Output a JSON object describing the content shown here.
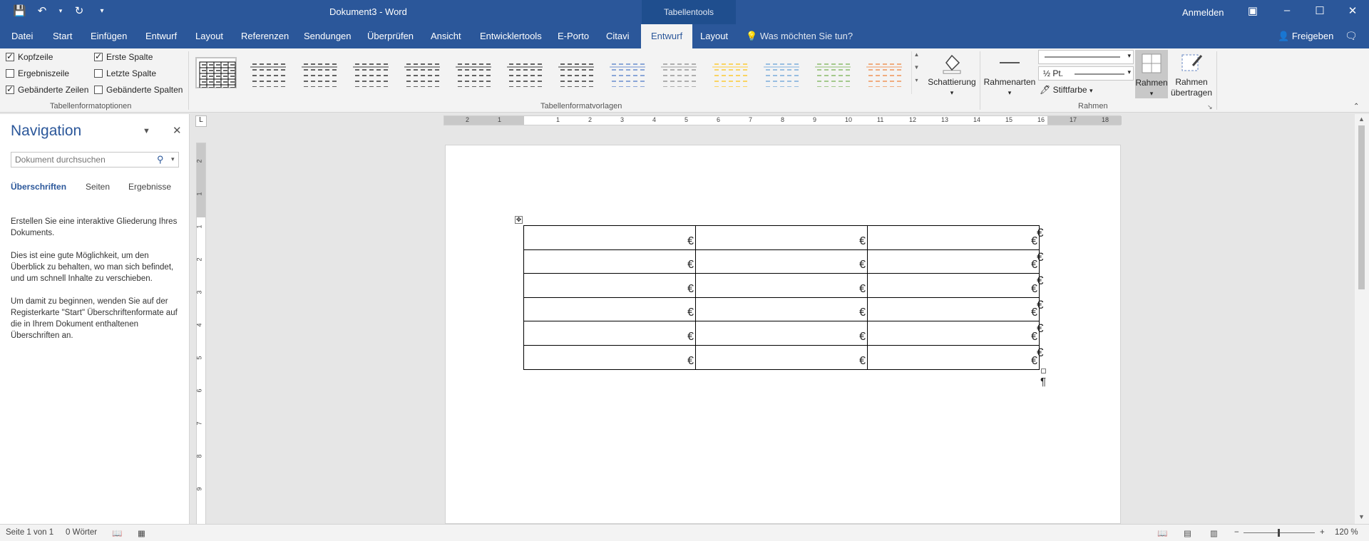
{
  "titlebar": {
    "doc_title": "Dokument3  -  Word",
    "context_label": "Tabellentools",
    "signin": "Anmelden",
    "qat": {
      "save_icon": "save-icon",
      "undo_icon": "undo-icon",
      "redo_icon": "redo-icon",
      "customize_icon": "customize-qat-icon"
    },
    "window": {
      "ribbon_display": "ribbon-display-icon",
      "minimize": "minimize-icon",
      "maximize": "maximize-icon",
      "close": "close-icon"
    }
  },
  "tabs": [
    "Datei",
    "Start",
    "Einfügen",
    "Entwurf",
    "Layout",
    "Referenzen",
    "Sendungen",
    "Überprüfen",
    "Ansicht",
    "Entwicklertools",
    "E-Porto",
    "Citavi",
    "Entwurf",
    "Layout"
  ],
  "tell_me": "Was möchten Sie tun?",
  "share": "Freigeben",
  "ribbon": {
    "options": {
      "header_row": "Kopfzeile",
      "total_row": "Ergebniszeile",
      "banded_rows": "Gebänderte Zeilen",
      "first_column": "Erste Spalte",
      "last_column": "Letzte Spalte",
      "banded_columns": "Gebänderte Spalten",
      "checked": {
        "header_row": true,
        "total_row": false,
        "banded_rows": true,
        "first_column": true,
        "last_column": false,
        "banded_columns": false
      },
      "group_label": "Tabellenformatoptionen"
    },
    "styles": {
      "group_label": "Tabellenformatvorlagen",
      "swatches": [
        "#000000",
        "#000000",
        "#000000",
        "#000000",
        "#000000",
        "#000000",
        "#000000",
        "#000000",
        "#4472c4",
        "#7f7f7f",
        "#ffc000",
        "#5b9bd5",
        "#70ad47",
        "#ed7d31"
      ]
    },
    "shading_label": "Schattierung",
    "border_styles_label": "Rahmenarten",
    "pen_weight": "½ Pt.",
    "pen_color_label": "Stiftfarbe",
    "borders_label": "Rahmen",
    "border_painter_label_1": "Rahmen",
    "border_painter_label_2": "übertragen",
    "borders_group_label": "Rahmen"
  },
  "ruler": {
    "h_numbers": [
      "2",
      "1",
      "1",
      "2",
      "3",
      "4",
      "5",
      "6",
      "7",
      "8",
      "9",
      "10",
      "11",
      "12",
      "13",
      "14",
      "15",
      "16",
      "17",
      "18"
    ],
    "v_numbers": [
      "2",
      "1",
      "1",
      "2",
      "3",
      "4",
      "5",
      "6",
      "7",
      "8",
      "9"
    ]
  },
  "navigation": {
    "title": "Navigation",
    "search_placeholder": "Dokument durchsuchen",
    "tabs": [
      "Überschriften",
      "Seiten",
      "Ergebnisse"
    ],
    "para1": "Erstellen Sie eine interaktive Gliederung Ihres Dokuments.",
    "para2": "Dies ist eine gute Möglichkeit, um den Überblick zu behalten, wo man sich befindet, und um schnell Inhalte zu verschieben.",
    "para3": "Um damit zu beginnen, wenden Sie auf der Registerkarte \"Start\" Überschriftenformate auf die in Ihrem Dokument enthaltenen Überschriften an."
  },
  "document": {
    "cell_mark": "€",
    "row_end_mark": "€",
    "paragraph_mark": "¶",
    "table_rows": 6,
    "table_cols": 3
  },
  "status": {
    "page": "Seite 1 von 1",
    "words": "0 Wörter",
    "zoom": "120 %"
  }
}
